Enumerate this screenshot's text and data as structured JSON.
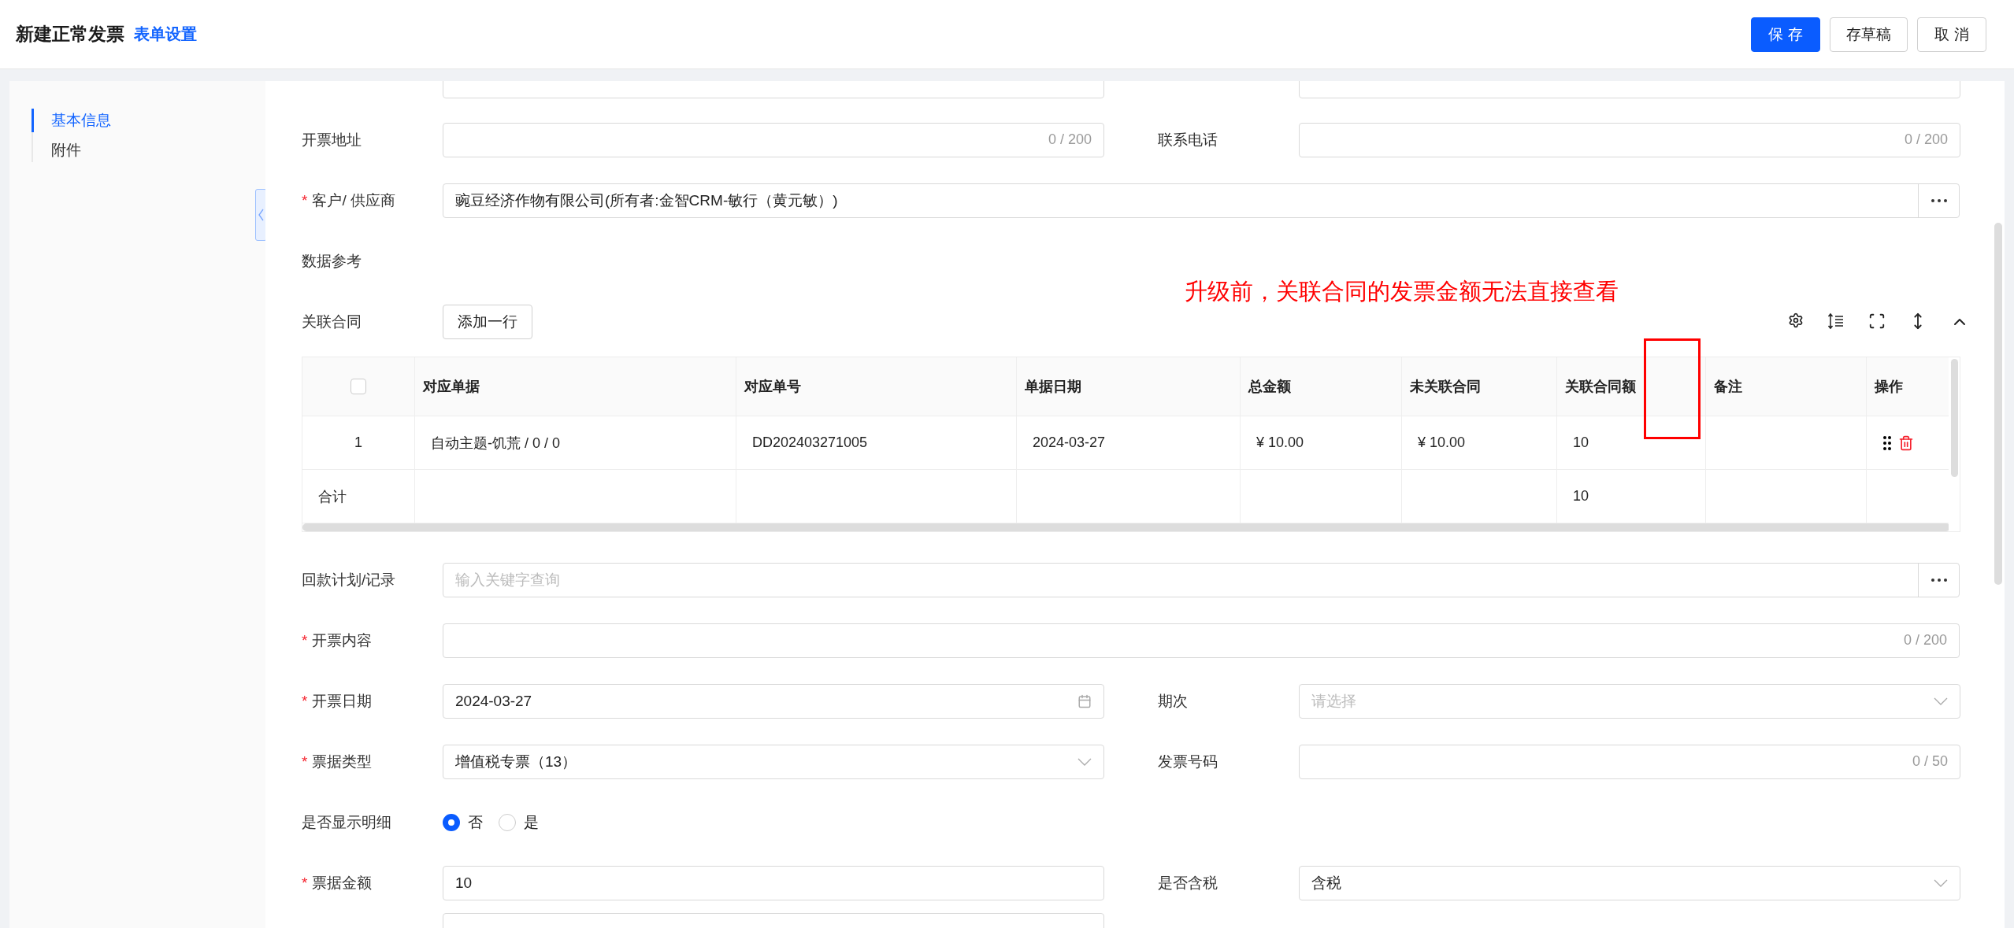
{
  "header": {
    "title": "新建正常发票",
    "settings_link": "表单设置",
    "buttons": [
      {
        "label": "保 存",
        "kind": "primary"
      },
      {
        "label": "存草稿",
        "kind": "default"
      },
      {
        "label": "取 消",
        "kind": "default"
      }
    ]
  },
  "sidebar": {
    "items": [
      {
        "label": "基本信息",
        "selected": true
      },
      {
        "label": "附件",
        "selected": false
      }
    ]
  },
  "annotation": {
    "text": "升级前，关联合同的发票金额无法直接查看"
  },
  "form_rows": [
    {
      "fields": [
        {
          "label": "开票地址",
          "kind": "text",
          "counter": "0 / 200"
        },
        {
          "label": "联系电话",
          "kind": "text",
          "counter": "0 / 200"
        }
      ]
    },
    {
      "fields": [
        {
          "required_mark": "*",
          "label": "客户/ 供应商",
          "kind": "lookup",
          "value": "豌豆经济作物有限公司(所有者:金智CRM-敏行（黄元敏）)"
        }
      ]
    },
    {
      "fields": [
        {
          "label": "数据参考",
          "kind": "section"
        }
      ]
    },
    {
      "fields": [
        {
          "label": "关联合同",
          "kind": "subtable",
          "button": "添加一行",
          "table": {
            "select_all_checked": false,
            "columns": [
              {
                "kind": "select"
              },
              {
                "kind": "text",
                "label": "对应单据"
              },
              {
                "kind": "text",
                "label": "对应单号"
              },
              {
                "kind": "text",
                "label": "单据日期"
              },
              {
                "kind": "text",
                "label": "总金额"
              },
              {
                "kind": "text",
                "label": "未关联合同"
              },
              {
                "kind": "text",
                "label": "关联合同额"
              },
              {
                "kind": "text",
                "label": "备注"
              },
              {
                "kind": "actions",
                "label": "操作"
              }
            ],
            "rows": [
              {
                "kind": "data",
                "cells": [
                  "1",
                  "自动主题-饥荒 / 0 / 0",
                  "DD202403271005",
                  "2024-03-27",
                  "¥ 10.00",
                  "¥ 10.00",
                  "10",
                  null,
                  null
                ]
              },
              {
                "kind": "total",
                "cells": [
                  "合计",
                  null,
                  null,
                  null,
                  null,
                  null,
                  "10",
                  null,
                  null
                ]
              }
            ]
          }
        }
      ]
    },
    {
      "fields": [
        {
          "label": "回款计划/记录",
          "kind": "lookup",
          "placeholder": "输入关键字查询"
        }
      ]
    },
    {
      "fields": [
        {
          "required_mark": "*",
          "label": "开票内容",
          "kind": "text",
          "counter": "0 / 200"
        }
      ]
    },
    {
      "fields": [
        {
          "required_mark": "*",
          "label": "开票日期",
          "kind": "date",
          "value": "2024-03-27"
        },
        {
          "label": "期次",
          "kind": "select",
          "placeholder": "请选择"
        }
      ]
    },
    {
      "fields": [
        {
          "required_mark": "*",
          "label": "票据类型",
          "kind": "select",
          "value": "增值税专票（13）"
        },
        {
          "label": "发票号码",
          "kind": "text",
          "counter": "0 / 50"
        }
      ]
    },
    {
      "fields": [
        {
          "label": "是否显示明细",
          "kind": "radio",
          "options": [
            {
              "label": "否",
              "selected": true
            },
            {
              "label": "是",
              "selected": false
            }
          ]
        }
      ]
    },
    {
      "fields": [
        {
          "required_mark": "*",
          "label": "票据金额",
          "kind": "text",
          "value": "10"
        },
        {
          "label": "是否含税",
          "kind": "select",
          "value": "含税"
        }
      ]
    }
  ]
}
